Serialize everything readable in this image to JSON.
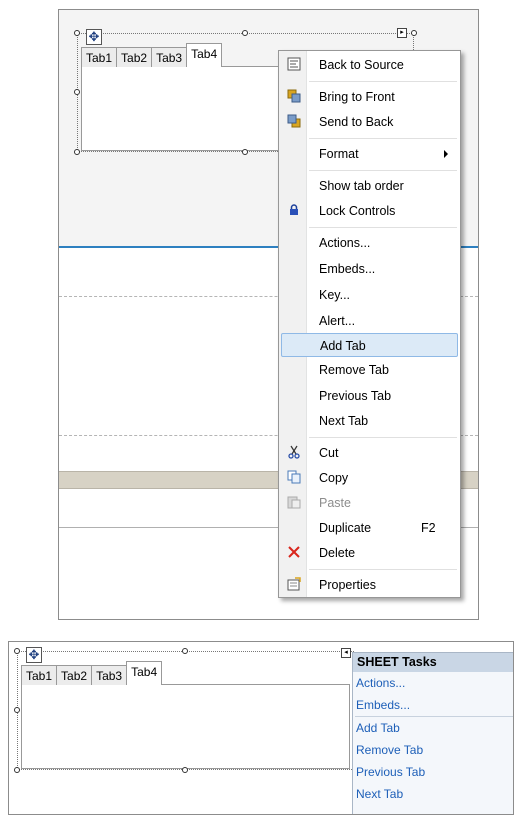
{
  "tab_control": {
    "tabs": [
      "Tab1",
      "Tab2",
      "Tab3",
      "Tab4"
    ],
    "active_tab": "Tab4"
  },
  "context_menu": {
    "items": [
      {
        "label": "Back to Source",
        "icon": "back-to-source-icon"
      },
      {
        "label": "Bring to Front",
        "icon": "bring-to-front-icon"
      },
      {
        "label": "Send to Back",
        "icon": "send-to-back-icon"
      },
      {
        "label": "Format",
        "submenu": true
      },
      {
        "label": "Show tab order"
      },
      {
        "label": "Lock Controls",
        "icon": "lock-icon"
      },
      {
        "label": "Actions..."
      },
      {
        "label": "Embeds..."
      },
      {
        "label": "Key..."
      },
      {
        "label": "Alert..."
      },
      {
        "label": "Add Tab",
        "highlighted": true
      },
      {
        "label": "Remove Tab"
      },
      {
        "label": "Previous Tab"
      },
      {
        "label": "Next Tab"
      },
      {
        "label": "Cut",
        "icon": "scissors-icon"
      },
      {
        "label": "Copy",
        "icon": "copy-icon"
      },
      {
        "label": "Paste",
        "icon": "paste-icon",
        "disabled": true
      },
      {
        "label": "Duplicate",
        "shortcut": "F2"
      },
      {
        "label": "Delete",
        "icon": "delete-icon"
      },
      {
        "label": "Properties",
        "icon": "properties-icon"
      }
    ]
  },
  "tasks_panel": {
    "title": "SHEET Tasks",
    "links": [
      "Actions...",
      "Embeds...",
      "Add Tab",
      "Remove Tab",
      "Previous Tab",
      "Next Tab"
    ]
  },
  "colors": {
    "accent_line": "#2e80c0",
    "menu_highlight": "#dceaf7",
    "link": "#1d5fb8",
    "delete_red": "#d9261c"
  }
}
